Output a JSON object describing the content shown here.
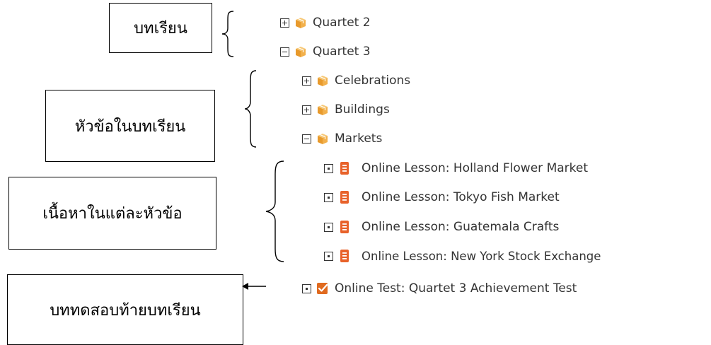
{
  "annotations": {
    "lesson_label": "บทเรียน",
    "topic_label": "หัวข้อในบทเรียน",
    "content_label": "เนื้อหาในแต่ละหัวข้อ",
    "test_label": "บททดสอบท้ายบทเรียน"
  },
  "tree": {
    "quartet2": {
      "label": "Quartet 2",
      "state": "collapsed",
      "icon": "package-icon"
    },
    "quartet3": {
      "label": "Quartet 3",
      "state": "expanded",
      "icon": "package-icon"
    },
    "celebrations": {
      "label": "Celebrations",
      "state": "collapsed",
      "icon": "package-icon"
    },
    "buildings": {
      "label": "Buildings",
      "state": "collapsed",
      "icon": "package-icon"
    },
    "markets": {
      "label": "Markets",
      "state": "expanded",
      "icon": "package-icon"
    },
    "lessons": [
      {
        "label": "Online Lesson: Holland Flower Market",
        "icon": "document-icon"
      },
      {
        "label": "Online Lesson: Tokyo Fish Market",
        "icon": "document-icon"
      },
      {
        "label": "Online Lesson: Guatemala Crafts",
        "icon": "document-icon"
      },
      {
        "label": "Online Lesson: New York Stock Exchange",
        "icon": "document-icon"
      }
    ],
    "test": {
      "label": "Online Test: Quartet 3 Achievement Test",
      "icon": "checklist-icon"
    }
  },
  "colors": {
    "package": "#f2b04b",
    "document": "#e8622a",
    "checklist": "#e06a1f"
  }
}
